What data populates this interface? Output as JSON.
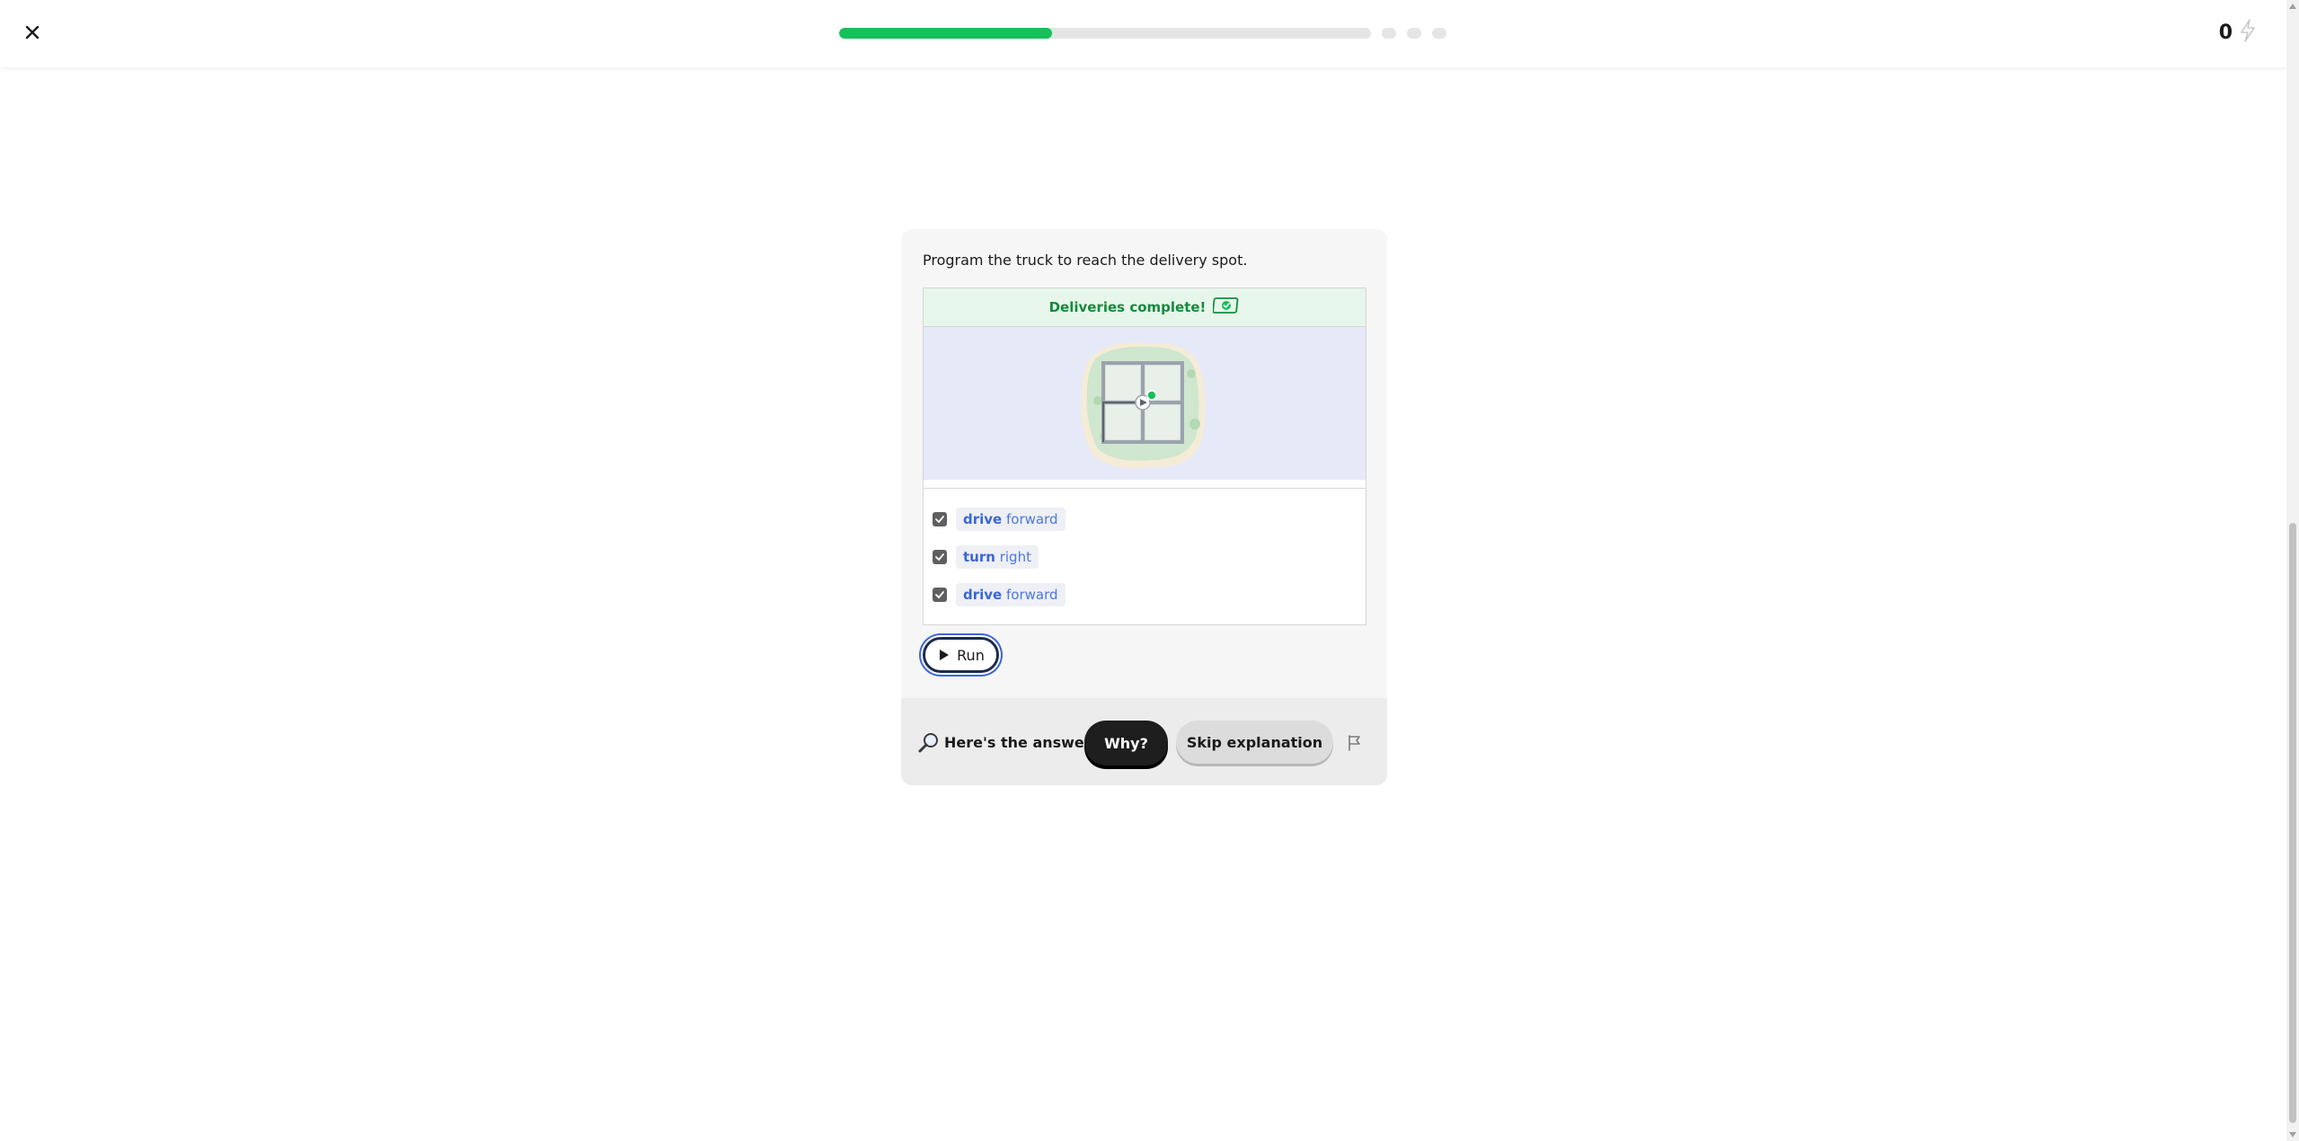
{
  "header": {
    "close_icon": "close-icon",
    "progress": 0.4,
    "progress_color": "#16c05a",
    "remaining_steps": 3,
    "streak_count": "0",
    "streak_icon": "lightning-icon"
  },
  "exercise": {
    "prompt": "Program the truck to reach the delivery spot.",
    "status": "Deliveries complete!",
    "status_icon": "package-delivered-icon",
    "commands": [
      {
        "verb": "drive",
        "arg": "forward",
        "checked": true
      },
      {
        "verb": "turn",
        "arg": "right",
        "checked": true
      },
      {
        "verb": "drive",
        "arg": "forward",
        "checked": true
      }
    ],
    "run_label": "Run"
  },
  "answer_bar": {
    "icon": "magnifier-icon",
    "label": "Here's the answer",
    "why_label": "Why?",
    "skip_label": "Skip explanation",
    "flag_icon": "flag-icon"
  },
  "colors": {
    "accent_blue": "#3b66d6",
    "success_green": "#168a3e",
    "dark_button": "#1e1e1e"
  }
}
